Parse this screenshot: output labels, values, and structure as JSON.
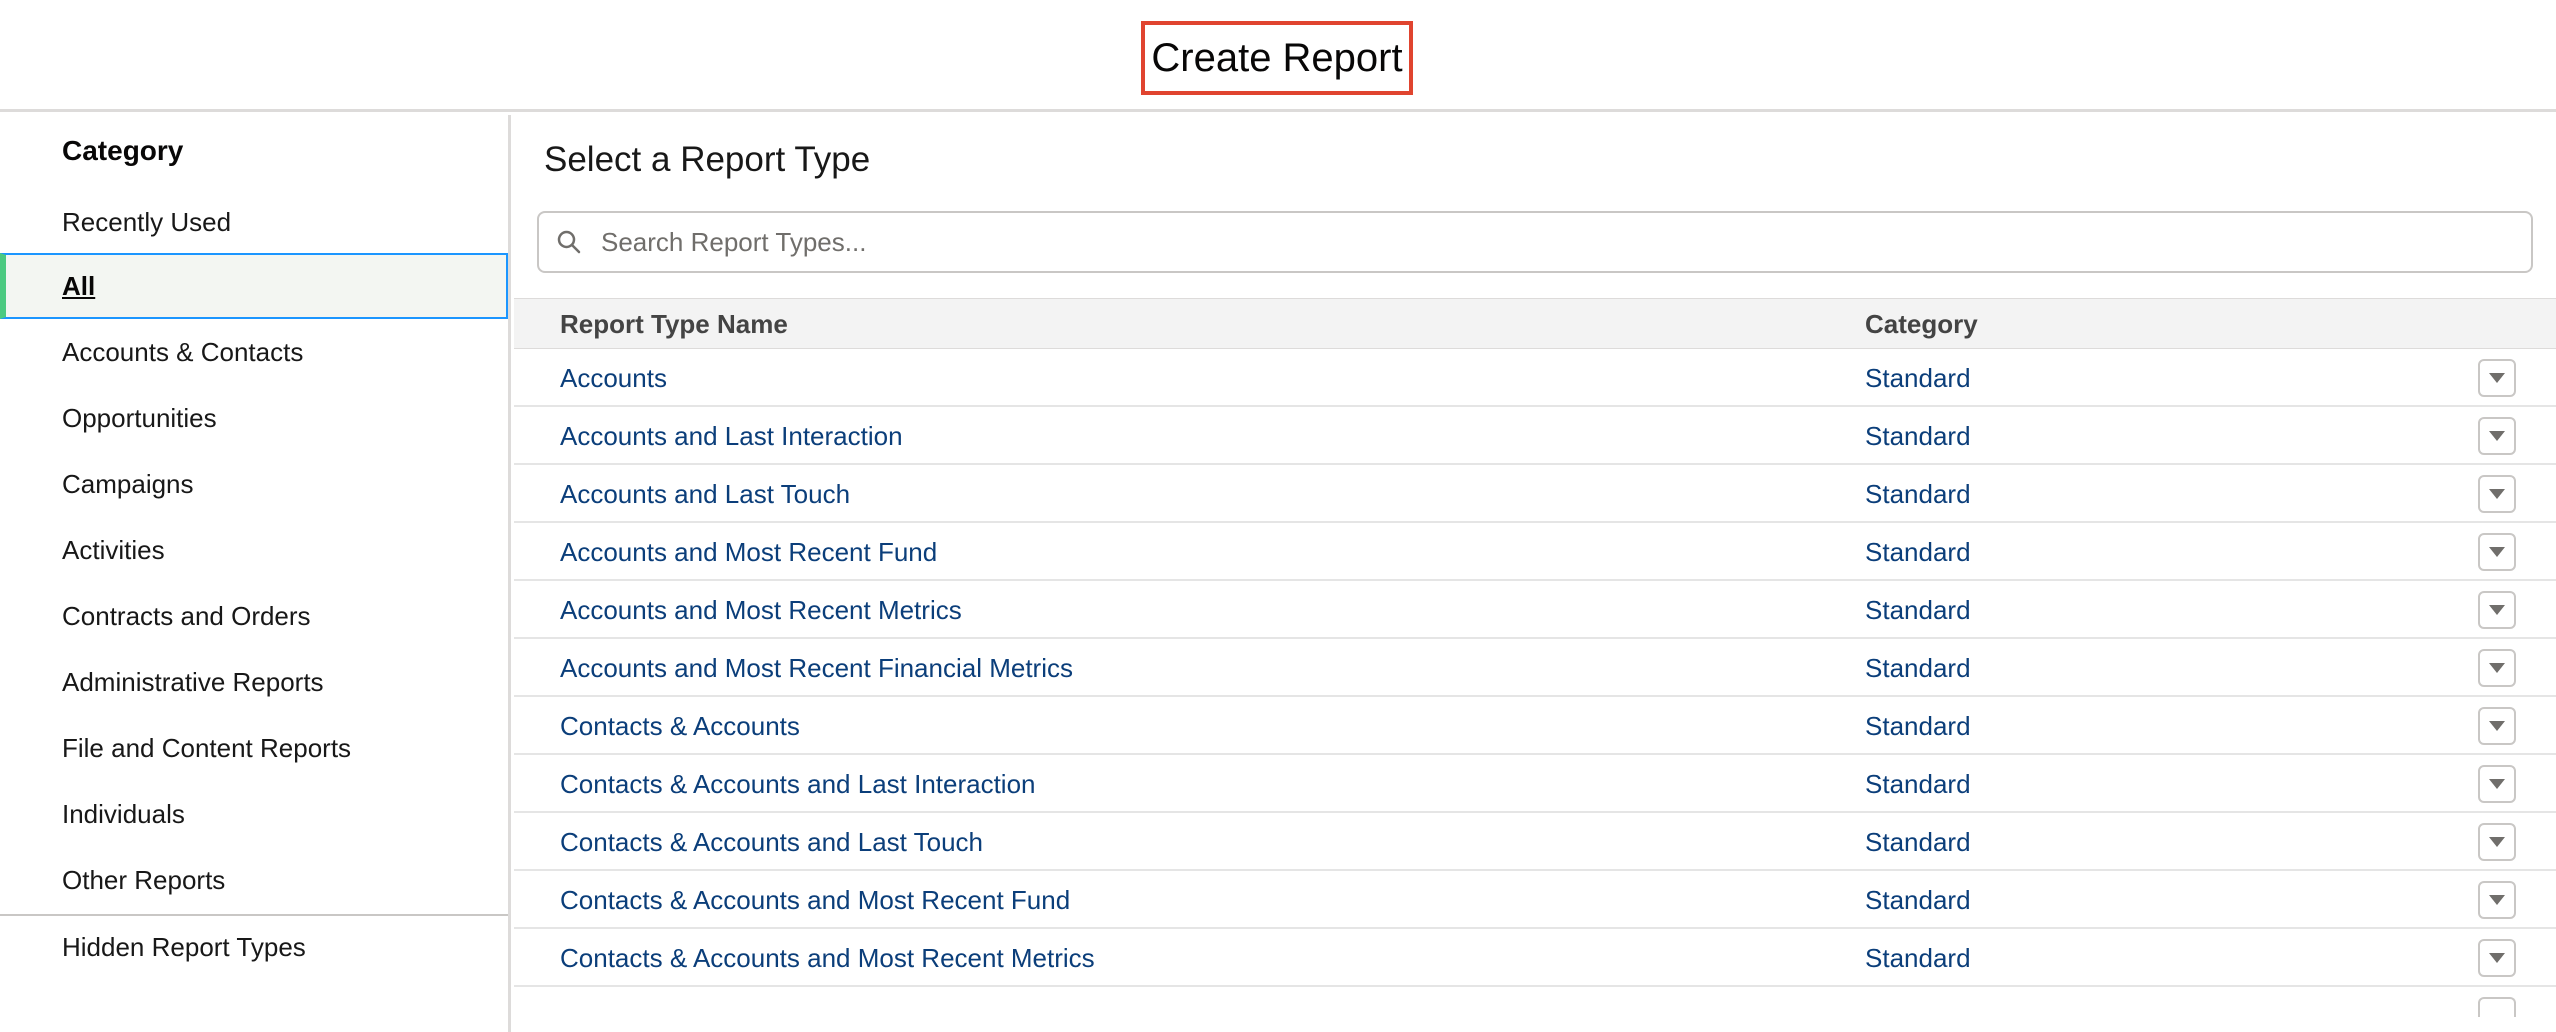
{
  "header": {
    "title": "Create Report"
  },
  "sidebar": {
    "heading": "Category",
    "recently_used": "Recently Used",
    "items": [
      {
        "label": "All",
        "selected": true
      },
      {
        "label": "Accounts & Contacts"
      },
      {
        "label": "Opportunities"
      },
      {
        "label": "Campaigns"
      },
      {
        "label": "Activities"
      },
      {
        "label": "Contracts and Orders"
      },
      {
        "label": "Administrative Reports"
      },
      {
        "label": "File and Content Reports"
      },
      {
        "label": "Individuals"
      },
      {
        "label": "Other Reports"
      }
    ],
    "hidden_types": "Hidden Report Types"
  },
  "main": {
    "heading": "Select a Report Type",
    "search": {
      "placeholder": "Search Report Types...",
      "value": ""
    },
    "table": {
      "columns": [
        "Report Type Name",
        "Category"
      ],
      "rows": [
        {
          "name": "Accounts",
          "category": "Standard"
        },
        {
          "name": "Accounts and Last Interaction",
          "category": "Standard"
        },
        {
          "name": "Accounts and Last Touch",
          "category": "Standard"
        },
        {
          "name": "Accounts and Most Recent Fund",
          "category": "Standard"
        },
        {
          "name": "Accounts and Most Recent Metrics",
          "category": "Standard"
        },
        {
          "name": "Accounts and Most Recent Financial Metrics",
          "category": "Standard"
        },
        {
          "name": "Contacts & Accounts",
          "category": "Standard"
        },
        {
          "name": "Contacts & Accounts and Last Interaction",
          "category": "Standard"
        },
        {
          "name": "Contacts & Accounts and Last Touch",
          "category": "Standard"
        },
        {
          "name": "Contacts & Accounts and Most Recent Fund",
          "category": "Standard"
        },
        {
          "name": "Contacts & Accounts and Most Recent Metrics",
          "category": "Standard"
        }
      ]
    }
  },
  "colors": {
    "title_highlight": "#e0442f",
    "link": "#0b3e7a",
    "selected_accent": "#4bca81",
    "selected_border": "#1b96ff"
  },
  "icons": {
    "search": "search-icon",
    "row_menu": "chevron-down-icon"
  }
}
